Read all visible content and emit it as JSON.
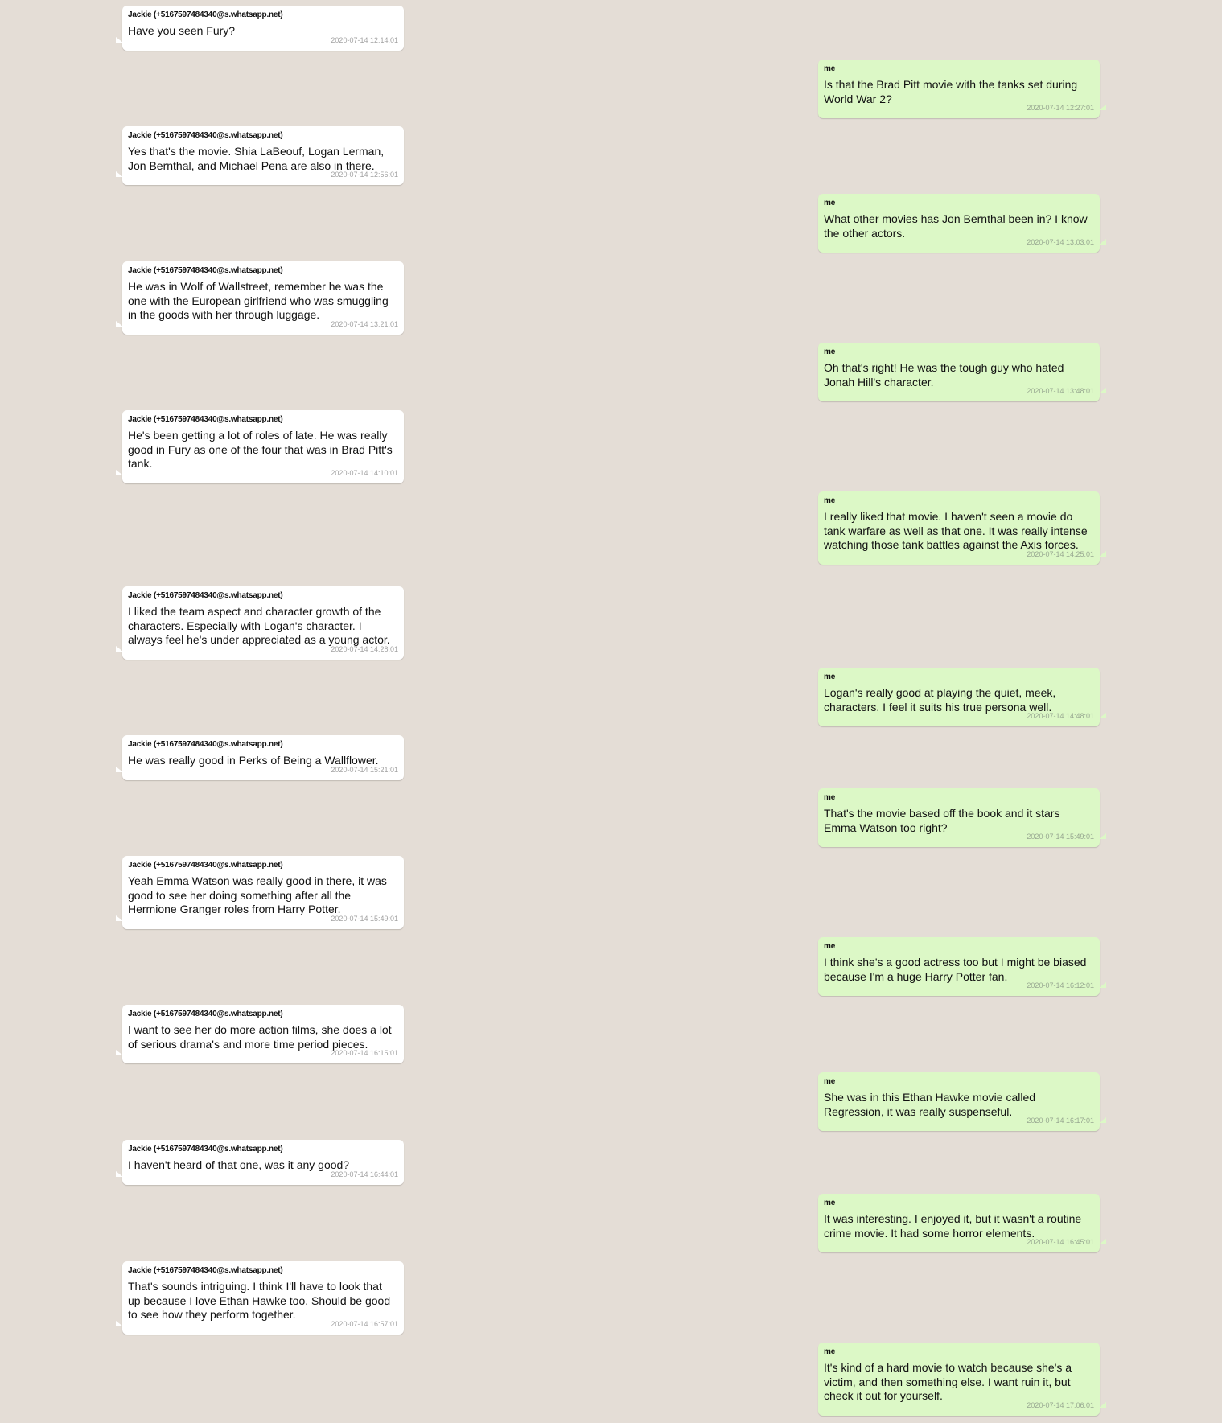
{
  "colors": {
    "background": "#e4ddd6",
    "incoming_bubble": "#ffffff",
    "outgoing_bubble": "#dcf8c6"
  },
  "messages": [
    {
      "side": "in",
      "sender": "Jackie (+5167597484340@s.whatsapp.net)",
      "text": "Have you seen Fury?",
      "time": "2020-07-14 12:14:01"
    },
    {
      "side": "out",
      "sender": "me",
      "text": "Is that the Brad Pitt movie with the tanks set during World War 2?",
      "time": "2020-07-14 12:27:01"
    },
    {
      "side": "in",
      "sender": "Jackie (+5167597484340@s.whatsapp.net)",
      "text": "Yes that's the movie. Shia LaBeouf, Logan Lerman, Jon Bernthal, and Michael Pena are also in there.",
      "time": "2020-07-14 12:56:01"
    },
    {
      "side": "out",
      "sender": "me",
      "text": "What other movies has Jon Bernthal been in? I know the other actors.",
      "time": "2020-07-14 13:03:01"
    },
    {
      "side": "in",
      "sender": "Jackie (+5167597484340@s.whatsapp.net)",
      "text": "He was in Wolf of Wallstreet, remember he was the one with the European girlfriend who was smuggling in the goods with her through luggage.",
      "time": "2020-07-14 13:21:01"
    },
    {
      "side": "out",
      "sender": "me",
      "text": "Oh that's right! He was the tough guy who hated Jonah Hill's character.",
      "time": "2020-07-14 13:48:01"
    },
    {
      "side": "in",
      "sender": "Jackie (+5167597484340@s.whatsapp.net)",
      "text": "He's been getting a lot of roles of late. He was really good in Fury as one of the four that was in Brad Pitt's tank.",
      "time": "2020-07-14 14:10:01"
    },
    {
      "side": "out",
      "sender": "me",
      "text": "I really liked that movie. I haven't seen a movie do tank warfare as well as that one. It was really intense watching those tank battles against the Axis forces.",
      "time": "2020-07-14 14:25:01"
    },
    {
      "side": "in",
      "sender": "Jackie (+5167597484340@s.whatsapp.net)",
      "text": "I liked the team aspect and character growth of the characters. Especially with Logan's character. I always feel he's under appreciated as a young actor.",
      "time": "2020-07-14 14:28:01"
    },
    {
      "side": "out",
      "sender": "me",
      "text": "Logan's really good at playing the quiet, meek, characters. I feel it suits his true persona well.",
      "time": "2020-07-14 14:48:01"
    },
    {
      "side": "in",
      "sender": "Jackie (+5167597484340@s.whatsapp.net)",
      "text": "He was really good in Perks of Being a Wallflower.",
      "time": "2020-07-14 15:21:01"
    },
    {
      "side": "out",
      "sender": "me",
      "text": "That's the movie based off the book and it stars Emma Watson too right?",
      "time": "2020-07-14 15:49:01"
    },
    {
      "side": "in",
      "sender": "Jackie (+5167597484340@s.whatsapp.net)",
      "text": "Yeah Emma Watson was really good in there, it was good to see her doing something after all the Hermione Granger roles from Harry Potter.",
      "time": "2020-07-14 15:49:01"
    },
    {
      "side": "out",
      "sender": "me",
      "text": "I think she's a good actress too but I might be biased because I'm a huge Harry Potter fan.",
      "time": "2020-07-14 16:12:01"
    },
    {
      "side": "in",
      "sender": "Jackie (+5167597484340@s.whatsapp.net)",
      "text": "I want to see her do more action films, she does a lot of serious drama's and more time period pieces.",
      "time": "2020-07-14 16:15:01"
    },
    {
      "side": "out",
      "sender": "me",
      "text": "She was in this Ethan Hawke movie called Regression, it was really suspenseful.",
      "time": "2020-07-14 16:17:01"
    },
    {
      "side": "in",
      "sender": "Jackie (+5167597484340@s.whatsapp.net)",
      "text": "I haven't heard of that one, was it any good?",
      "time": "2020-07-14 16:44:01"
    },
    {
      "side": "out",
      "sender": "me",
      "text": "It was interesting. I enjoyed it, but it wasn't a routine crime movie. It had some horror elements.",
      "time": "2020-07-14 16:45:01"
    },
    {
      "side": "in",
      "sender": "Jackie (+5167597484340@s.whatsapp.net)",
      "text": "That's sounds intriguing. I think I'll have to look that up because I love Ethan Hawke too. Should be good to see how they perform together.",
      "time": "2020-07-14 16:57:01"
    },
    {
      "side": "out",
      "sender": "me",
      "text": "It's kind of a hard movie to watch because she's a victim, and then something else. I want ruin it, but check it out for yourself.",
      "time": "2020-07-14 17:06:01"
    }
  ]
}
